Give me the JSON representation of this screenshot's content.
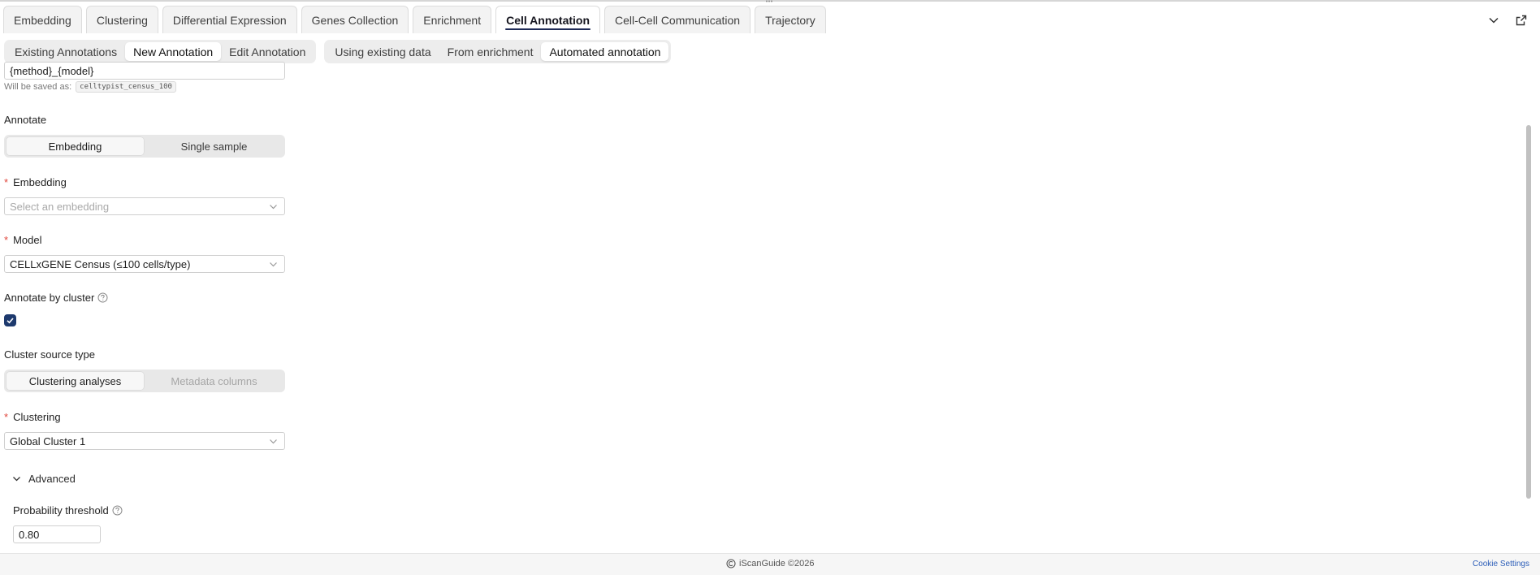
{
  "tabs": [
    {
      "label": "Embedding"
    },
    {
      "label": "Clustering"
    },
    {
      "label": "Differential Expression"
    },
    {
      "label": "Genes Collection"
    },
    {
      "label": "Enrichment"
    },
    {
      "label": "Cell Annotation",
      "active": true
    },
    {
      "label": "Cell-Cell Communication"
    },
    {
      "label": "Trajectory"
    }
  ],
  "annotation_modes": [
    "Existing Annotations",
    "New Annotation",
    "Edit Annotation"
  ],
  "annotation_mode_active": "New Annotation",
  "source_modes": [
    "Using existing data",
    "From enrichment",
    "Automated annotation"
  ],
  "source_mode_active": "Automated annotation",
  "form": {
    "name_value": "{method}_{model}",
    "saved_as_label": "Will be saved as:",
    "saved_as_value": "celltypist_census_100",
    "annotate_label": "Annotate",
    "annotate_options": [
      "Embedding",
      "Single sample"
    ],
    "annotate_selected": "Embedding",
    "embedding_label": "Embedding",
    "embedding_placeholder": "Select an embedding",
    "model_label": "Model",
    "model_value": "CELLxGENE Census (≤100 cells/type)",
    "annotate_by_cluster_label": "Annotate by cluster",
    "annotate_by_cluster_checked": true,
    "cluster_source_label": "Cluster source type",
    "cluster_source_options": [
      "Clustering analyses",
      "Metadata columns"
    ],
    "cluster_source_selected": "Clustering analyses",
    "clustering_label": "Clustering",
    "clustering_value": "Global Cluster 1",
    "advanced_label": "Advanced",
    "probability_label": "Probability threshold",
    "probability_value": "0.80"
  },
  "footer": {
    "brand": "iScanGuide ©2026",
    "cookie_settings": "Cookie Settings"
  },
  "colors": {
    "accent": "#1e2a56",
    "checkbox": "#1e3a6e",
    "required": "#e0463c",
    "link": "#2b5db8"
  }
}
